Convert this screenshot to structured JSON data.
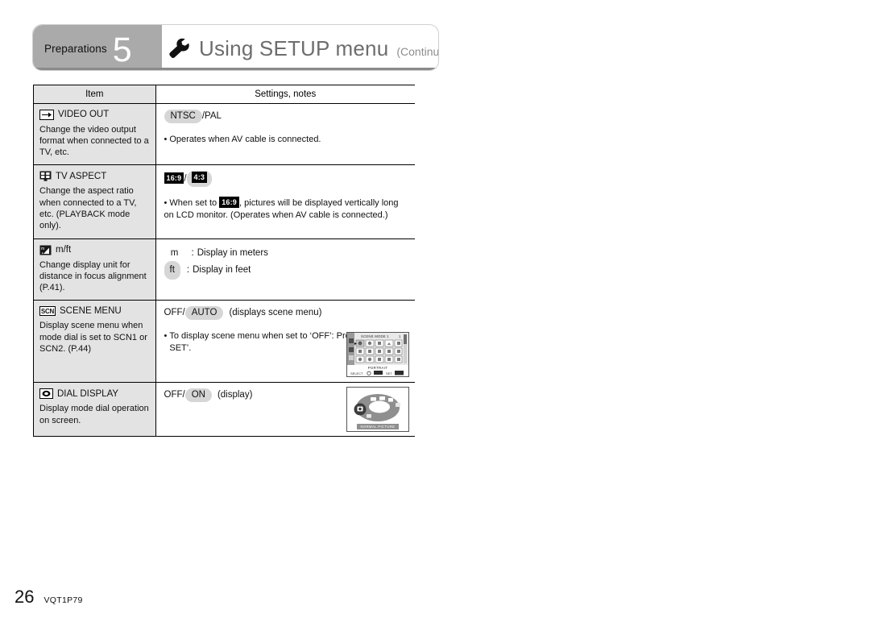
{
  "header": {
    "chapter_label": "Preparations",
    "chapter_number": "5",
    "icon": "wrench-icon",
    "title": "Using SETUP menu",
    "continued": "(Continued)"
  },
  "table": {
    "columns": [
      "Item",
      "Settings, notes"
    ],
    "rows": [
      {
        "icon": "video-out-icon",
        "item_title": "VIDEO OUT",
        "item_desc": "Change the video output format when connected to a TV, etc.",
        "options": [
          {
            "text": "NTSC",
            "style": "pill-selected"
          },
          {
            "text": "/PAL",
            "style": "plain"
          }
        ],
        "notes": [
          {
            "bullet": "•",
            "text": "Operates when AV cable is connected."
          }
        ]
      },
      {
        "icon": "tv-aspect-icon",
        "item_title": "TV ASPECT",
        "item_desc": "Change the aspect ratio when connected to a TV, etc. (PLAYBACK mode only).",
        "options": [
          {
            "text": "16:9",
            "style": "badge-black"
          },
          {
            "text": "/",
            "style": "plain"
          },
          {
            "text": "4:3",
            "style": "badge-black-highlighted"
          }
        ],
        "notes": [
          {
            "bullet": "•",
            "text_before": "When set to ",
            "inline_badge": "16:9",
            "text_after": ", pictures will be displayed vertically long on LCD monitor. (Operates when AV cable is connected.)"
          }
        ]
      },
      {
        "icon": "meters-feet-icon",
        "item_title": "m/ft",
        "item_desc": "Change display unit for distance in focus alignment (P.41).",
        "unit_rows": [
          {
            "key": "m",
            "key_style": "plain",
            "separator": ":",
            "text": "Display in meters"
          },
          {
            "key": "ft",
            "key_style": "pill-selected",
            "separator": ":",
            "text": "Display in feet"
          }
        ]
      },
      {
        "icon": "scn-icon",
        "icon_label": "SCN",
        "item_title": "SCENE MENU",
        "item_desc": "Display scene menu when mode dial is set to SCN1 or SCN2. (P.44)",
        "options": [
          {
            "text": "OFF/",
            "style": "plain"
          },
          {
            "text": "AUTO",
            "style": "pill-selected"
          },
          {
            "text": "(displays scene menu)",
            "style": "plain-spaced"
          }
        ],
        "notes": [
          {
            "bullet": "•",
            "text": "To display scene menu when set to ‘OFF’: Press ‘MENU/ SET’."
          }
        ],
        "thumbnail": {
          "name": "scene-mode-screen-thumbnail",
          "title": "SCENE MODE 1",
          "page_indicator": "1",
          "selected_label": "PORTRAIT",
          "footer_left": "SELECT",
          "footer_right": "SET"
        }
      },
      {
        "icon": "dial-display-icon",
        "item_title": "DIAL DISPLAY",
        "item_desc": "Display mode dial operation on screen.",
        "options": [
          {
            "text": "OFF/",
            "style": "plain"
          },
          {
            "text": "ON",
            "style": "pill-selected"
          },
          {
            "text": "(display)",
            "style": "plain-spaced"
          }
        ],
        "thumbnail": {
          "name": "mode-dial-screen-thumbnail",
          "label": "NORMAL PICTURE"
        }
      }
    ]
  },
  "footer": {
    "page_number": "26",
    "doc_code": "VQT1P79"
  },
  "colors": {
    "header_tab_bg": "#aaaaaa",
    "item_column_bg": "#e3e3e3",
    "pill_bg": "#d6d6d6",
    "badge_bg": "#000000",
    "title_text": "#6d6d6d"
  }
}
